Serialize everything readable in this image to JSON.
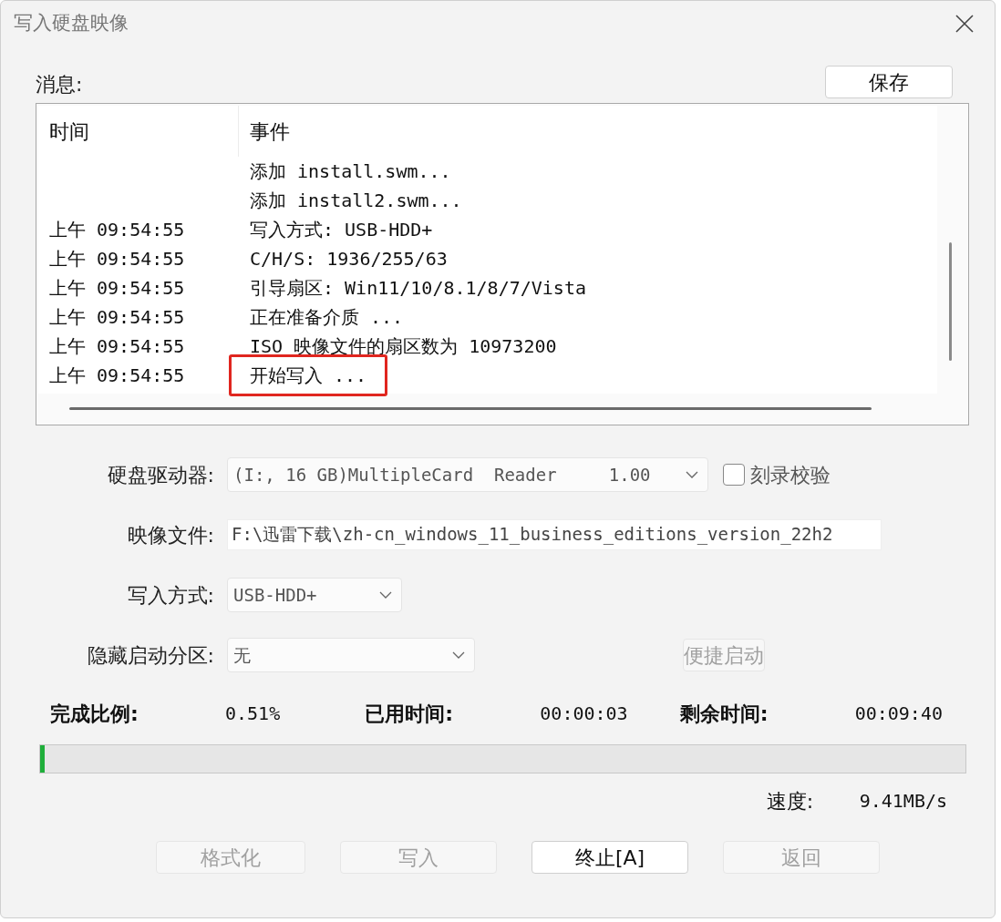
{
  "window": {
    "title": "写入硬盘映像"
  },
  "messages": {
    "label": "消息:",
    "save_button": "保存",
    "columns": [
      "时间",
      "事件"
    ],
    "rows": [
      {
        "event": "添加 install.swm...",
        "highlighted": false
      },
      {
        "event": "添加 install2.swm...",
        "highlighted": false
      },
      {
        "time": "上午 09:54:55",
        "event": "写入方式: USB-HDD+",
        "highlighted": false
      },
      {
        "time": "上午 09:54:55",
        "event": "C/H/S: 1936/255/63",
        "highlighted": false
      },
      {
        "time": "上午 09:54:55",
        "event": "引导扇区: Win11/10/8.1/8/7/Vista",
        "highlighted": false
      },
      {
        "time": "上午 09:54:55",
        "event": "正在准备介质 ...",
        "highlighted": false
      },
      {
        "time": "上午 09:54:55",
        "event": "ISO 映像文件的扇区数为 10973200",
        "highlighted": false
      },
      {
        "time": "上午 09:54:55",
        "event": "开始写入 ...",
        "highlighted": true
      }
    ]
  },
  "form": [
    {
      "kind": "select",
      "label": "硬盘驱动器:",
      "value": "(I:, 16 GB)MultipleCard  Reader     1.00",
      "checkbox": {
        "label": "刻录校验",
        "checked": false
      }
    },
    {
      "kind": "text",
      "label": "映像文件:",
      "value": "F:\\迅雷下载\\zh-cn_windows_11_business_editions_version_22h2"
    },
    {
      "kind": "select",
      "label": "写入方式:",
      "value": "USB-HDD+"
    },
    {
      "kind": "select",
      "label": "隐藏启动分区:",
      "value": "无",
      "button": {
        "label": "便捷启动",
        "disabled": true
      }
    }
  ],
  "stats": [
    {
      "label": "完成比例:",
      "value": "0.51%"
    },
    {
      "label": "已用时间:",
      "value": "00:00:03"
    },
    {
      "label": "剩余时间:",
      "value": "00:09:40"
    }
  ],
  "progress": {
    "level": 0.0051
  },
  "speed": {
    "label": "速度:",
    "value": "9.41MB/s"
  },
  "buttons": [
    {
      "label": "格式化",
      "disabled": true
    },
    {
      "label": "写入",
      "disabled": true
    },
    {
      "label": "终止[A]",
      "disabled": false
    },
    {
      "label": "返回",
      "disabled": true
    }
  ]
}
